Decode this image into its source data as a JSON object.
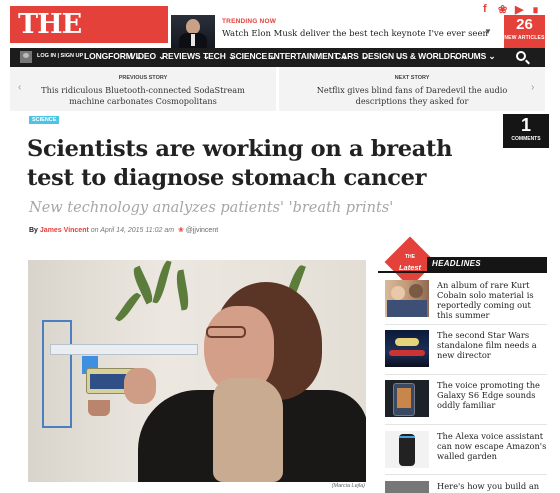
{
  "brand": {
    "logo": "THE VERGE",
    "accent": "#e5413b"
  },
  "trending": {
    "label": "TRENDING NOW",
    "text": "Watch Elon Musk deliver the best tech keynote I've ever seen"
  },
  "social_icons": [
    "facebook-icon",
    "twitter-icon",
    "youtube-icon",
    "rss-icon"
  ],
  "new_articles": {
    "count": "26",
    "label": "NEW ARTICLES"
  },
  "nav": {
    "login": "LOG IN | SIGN UP",
    "items": [
      "LONGFORM",
      "VIDEO",
      "REVIEWS",
      "TECH",
      "SCIENCE",
      "ENTERTAINMENT",
      "CARS",
      "DESIGN",
      "US & WORLD",
      "FORUMS"
    ]
  },
  "prev_story": {
    "label": "PREVIOUS STORY",
    "text": "This ridiculous Bluetooth-connected SodaStream machine carbonates Cosmopolitans"
  },
  "next_story": {
    "label": "NEXT STORY",
    "text": "Netflix gives blind fans of Daredevil the audio descriptions they asked for"
  },
  "article": {
    "tag": "SCIENCE",
    "comments_count": "1",
    "comments_label": "COMMENTS",
    "headline": "Scientists are working on a breath test to diagnose stomach cancer",
    "subhead": "New technology analyzes patients' 'breath prints'",
    "by": "By",
    "author": "James Vincent",
    "date": "on April 14, 2015 11:02 am",
    "twitter": "@jjvincent",
    "photo_credit": "(Marcia Lejla)"
  },
  "latest": {
    "badge_top": "THE",
    "badge_main": "Latest",
    "title": "HEADLINES",
    "items": [
      {
        "text": "An album of rare Kurt Cobain solo material is reportedly coming out this summer"
      },
      {
        "text": "The second Star Wars standalone film needs a new director"
      },
      {
        "text": "The voice promoting the Galaxy S6 Edge sounds oddly familiar"
      },
      {
        "text": "The Alexa voice assistant can now escape Amazon's walled garden"
      },
      {
        "text": "Here's how you build an"
      }
    ]
  }
}
